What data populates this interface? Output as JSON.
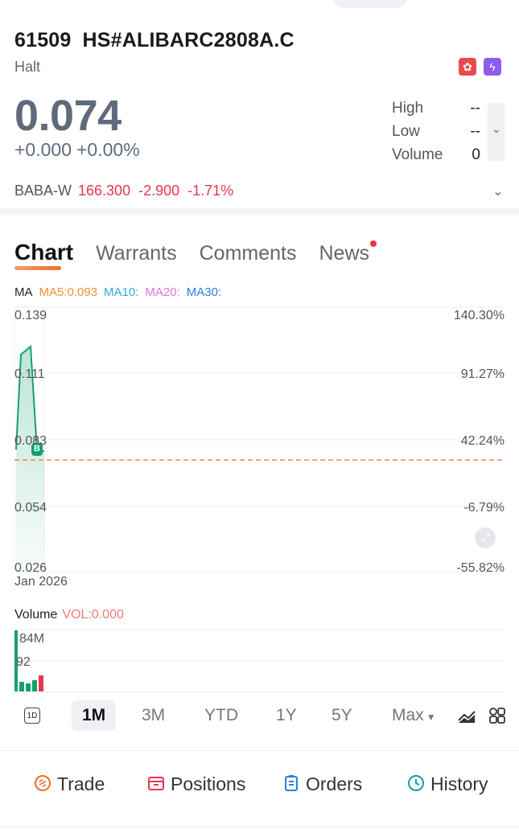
{
  "header": {
    "code": "61509",
    "name": "HS#ALIBARC2808A.C",
    "status": "Halt"
  },
  "quote": {
    "price": "0.074",
    "change": "+0.000",
    "change_pct": "+0.00%"
  },
  "stats": [
    {
      "label": "High",
      "value": "--"
    },
    {
      "label": "Low",
      "value": "--"
    },
    {
      "label": "Volume",
      "value": "0"
    }
  ],
  "underlying": {
    "name": "BABA-W",
    "price": "166.300",
    "change": "-2.900",
    "change_pct": "-1.71%"
  },
  "tabs": [
    {
      "label": "Chart"
    },
    {
      "label": "Warrants"
    },
    {
      "label": "Comments"
    },
    {
      "label": "News"
    }
  ],
  "ma": {
    "label": "MA",
    "ma5": "MA5:0.093",
    "ma10": "MA10:",
    "ma20": "MA20:",
    "ma30": "MA30:"
  },
  "chart": {
    "y_left": [
      "0.139",
      "0.111",
      "0.083",
      "0.054",
      "0.026"
    ],
    "y_right": [
      "140.30%",
      "91.27%",
      "42.24%",
      "-6.79%",
      "-55.82%"
    ],
    "x_label": "Jan 2026",
    "marker": "B"
  },
  "volume": {
    "label": "Volume",
    "value": "VOL:0.000",
    "ticks": [
      "84M",
      "92"
    ]
  },
  "periods": [
    "1M",
    "3M",
    "YTD",
    "1Y",
    "5Y",
    "Max"
  ],
  "period_1d_label": "1D",
  "actions": [
    {
      "label": "Trade"
    },
    {
      "label": "Positions"
    },
    {
      "label": "Orders"
    },
    {
      "label": "History"
    }
  ],
  "colors": {
    "up": "#e8364f",
    "down": "#16a06b",
    "accent": "#ee6f2c",
    "ma5": "#f0902f",
    "ma10": "#2ca9e0",
    "ma20": "#e073d6",
    "ma30": "#2a7fe0"
  }
}
